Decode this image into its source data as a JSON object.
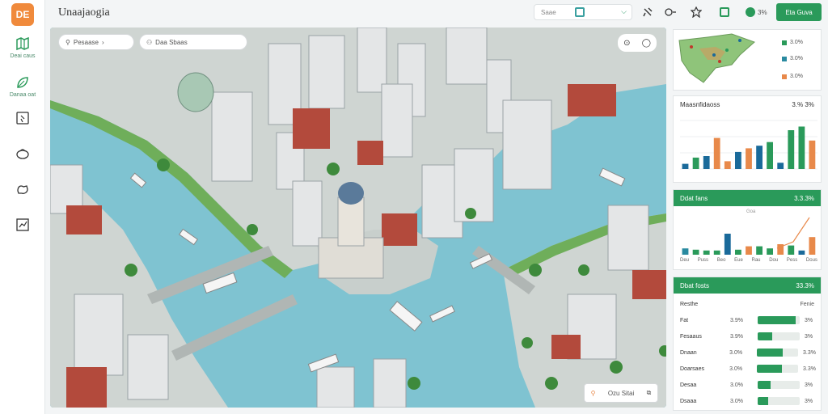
{
  "app": {
    "logo": "DE",
    "title": "Unaajaogia"
  },
  "sidebar": {
    "items": [
      {
        "label": "Deai caus",
        "icon": "map-icon"
      },
      {
        "label": "Danaa oat",
        "icon": "leaf-icon"
      },
      {
        "label": "",
        "icon": "pin-icon"
      },
      {
        "label": "",
        "icon": "bag-icon"
      },
      {
        "label": "",
        "icon": "hand-icon"
      },
      {
        "label": "",
        "icon": "chart-icon"
      }
    ]
  },
  "topbar": {
    "search_placeholder": "Saae",
    "chip1": "3%",
    "chip2": "Eta Guva"
  },
  "map": {
    "search1": "Pesaase",
    "search2": "Daa Sbaas",
    "bottom_label": "Ozu Sitai"
  },
  "panel1": {
    "legend": [
      {
        "label": "3.0%",
        "color": "#2a9a5a"
      },
      {
        "label": "3.0%",
        "color": "#2a8aa0"
      },
      {
        "label": "3.0%",
        "color": "#e8894a"
      }
    ]
  },
  "panel2": {
    "title": "Maasnfidaoss",
    "value": "3.% 3%",
    "chart_data": {
      "type": "bar",
      "series": [
        {
          "values": [
            0.1,
            0.22,
            0.25,
            0.6,
            0.15,
            0.33,
            0.4,
            0.45,
            0.52,
            0.12,
            0.75,
            0.82,
            0.55
          ]
        }
      ],
      "colors": [
        "#1a6a9a",
        "#2a9a5a",
        "#1a6a9a",
        "#e8894a",
        "#e8894a",
        "#1a6a9a",
        "#e8894a",
        "#1a6a9a",
        "#2a9a5a",
        "#1a6a9a",
        "#2a9a5a",
        "#2a9a5a",
        "#e8894a"
      ]
    }
  },
  "panel3": {
    "title": "Ddat fans",
    "value": "3.3.3%",
    "sub": "Goa",
    "chart_data": {
      "type": "bar",
      "series": [
        {
          "values": [
            0.15,
            0.12,
            0.1,
            0.1,
            0.5,
            0.12,
            0.2,
            0.2,
            0.15,
            0.25,
            0.22,
            0.1,
            0.42
          ]
        }
      ],
      "colors": [
        "#2a8aa0",
        "#2a9a5a",
        "#2a9a5a",
        "#2a9a5a",
        "#1a6a9a",
        "#2a9a5a",
        "#e8894a",
        "#2a9a5a",
        "#2a9a5a",
        "#e8894a",
        "#2a9a5a",
        "#1a6a9a",
        "#e8894a"
      ]
    },
    "x_labels": [
      "Deu",
      "Puss",
      "Beo",
      "Eue",
      "Rau",
      "Dou",
      "Pess",
      "Dous"
    ]
  },
  "panel4": {
    "title": "Dbat fosts",
    "value": "33.3%",
    "col1": "Resthe",
    "col2": "Fenie",
    "rows": [
      {
        "name": "Fat",
        "pct": "3.9%",
        "fill": 0.9,
        "val": "3%",
        "color": "#2a9a5a"
      },
      {
        "name": "Fesaaus",
        "pct": "3.9%",
        "fill": 0.35,
        "val": "3%",
        "color": "#2a9a5a"
      },
      {
        "name": "Dnaan",
        "pct": "3.0%",
        "fill": 0.62,
        "val": "3.3%",
        "color": "#2a9a5a"
      },
      {
        "name": "Doarsaes",
        "pct": "3.0%",
        "fill": 0.6,
        "val": "3.3%",
        "color": "#2a9a5a"
      },
      {
        "name": "Desaa",
        "pct": "3.0%",
        "fill": 0.3,
        "val": "3%",
        "color": "#2a9a5a"
      },
      {
        "name": "Dsaaa",
        "pct": "3.0%",
        "fill": 0.25,
        "val": "3%",
        "color": "#2a9a5a"
      }
    ]
  }
}
